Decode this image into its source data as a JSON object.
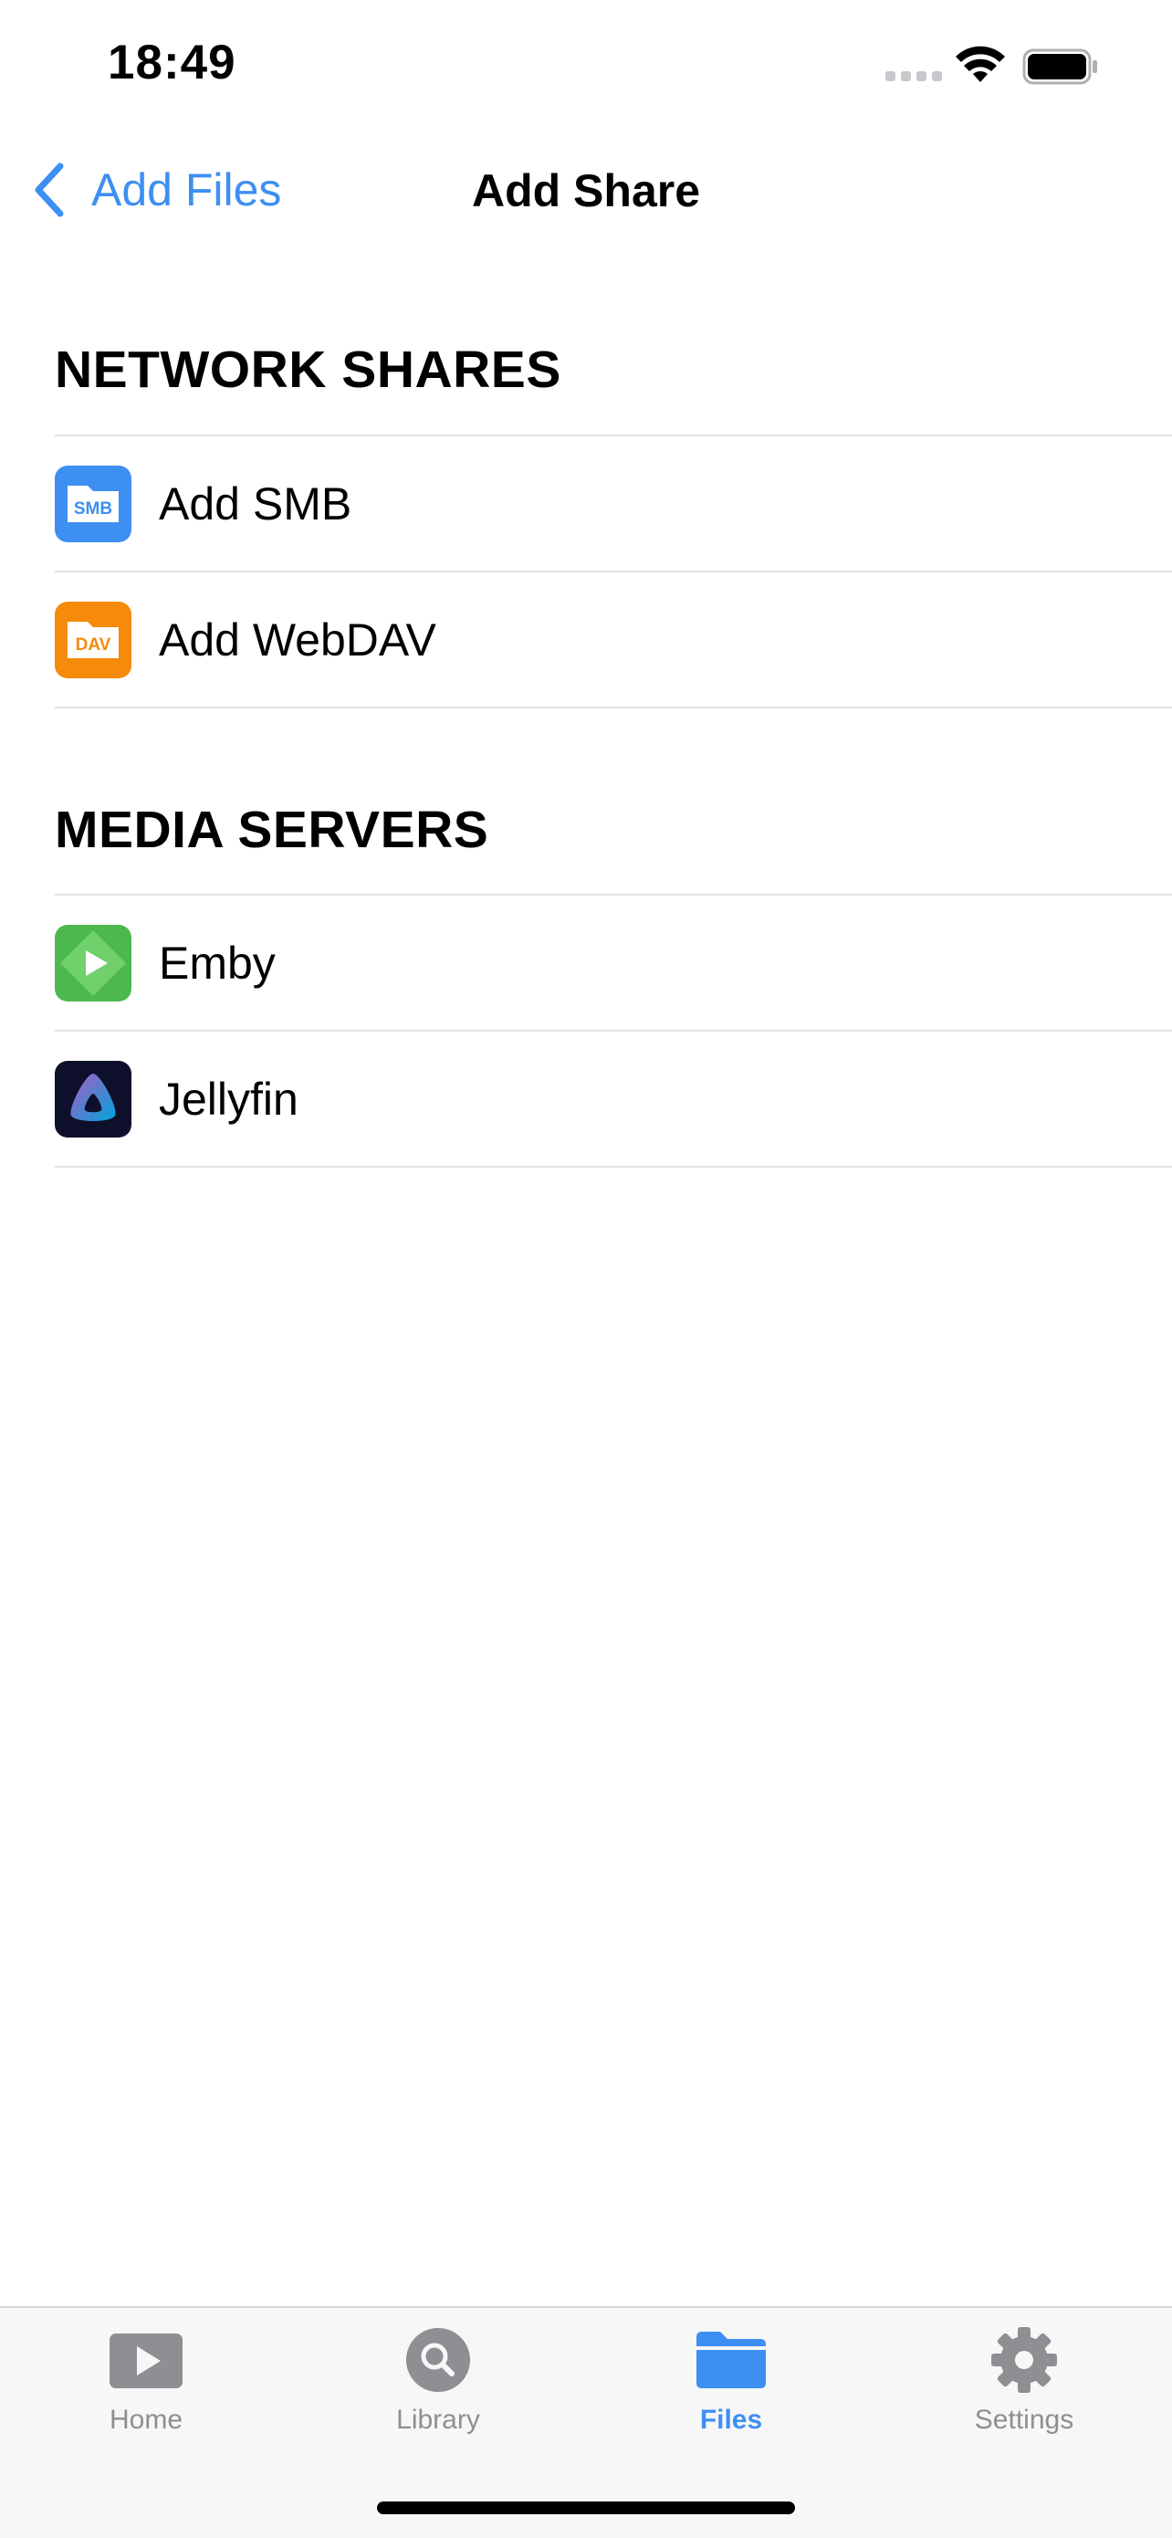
{
  "status_bar": {
    "time": "18:49"
  },
  "nav": {
    "back_label": "Add Files",
    "title": "Add Share"
  },
  "sections": {
    "network": {
      "header": "NETWORK SHARES",
      "items": [
        {
          "label": "Add SMB",
          "icon": "smb-icon",
          "icon_text": "SMB"
        },
        {
          "label": "Add WebDAV",
          "icon": "webdav-icon",
          "icon_text": "DAV"
        }
      ]
    },
    "media": {
      "header": "MEDIA SERVERS",
      "items": [
        {
          "label": "Emby",
          "icon": "emby-icon"
        },
        {
          "label": "Jellyfin",
          "icon": "jellyfin-icon"
        }
      ]
    }
  },
  "tab_bar": {
    "tabs": [
      {
        "label": "Home",
        "icon": "play-icon"
      },
      {
        "label": "Library",
        "icon": "search-icon"
      },
      {
        "label": "Files",
        "icon": "folder-icon",
        "active": true
      },
      {
        "label": "Settings",
        "icon": "gear-icon"
      }
    ]
  },
  "colors": {
    "accent": "#3d8ff2",
    "smb": "#3d8ff2",
    "webdav": "#f58a0b",
    "emby": "#4cb84e",
    "jellyfin_bg": "#0d0f2b",
    "inactive_tab": "#8e8e93"
  }
}
